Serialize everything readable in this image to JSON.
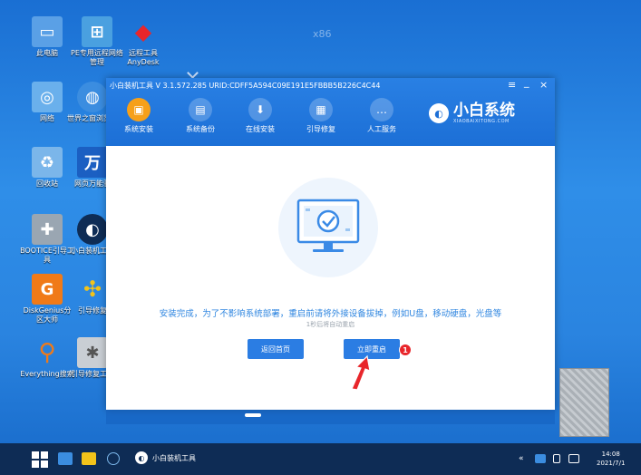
{
  "desktop": {
    "watermark": "x86",
    "icons": [
      {
        "label": "此电脑",
        "icon": "computer-icon",
        "color": "#5aa0e6"
      },
      {
        "label": "PE专用远程网络管理",
        "icon": "network-icon",
        "color": "#4aa0e0"
      },
      {
        "label": "远程工具AnyDesk",
        "icon": "anydesk-icon",
        "color": "#e8262b"
      },
      {
        "label": "网络",
        "icon": "network-icon",
        "color": "#6ab0ec"
      },
      {
        "label": "世界之窗浏览器",
        "icon": "globe-icon",
        "color": "#3b8de0"
      },
      {
        "label": "回收站",
        "icon": "recycle-bin-icon",
        "color": "#7bb6ea"
      },
      {
        "label": "网页万能驱",
        "icon": "wan-icon",
        "color": "#1b5fc2"
      },
      {
        "label": "BOOTICE引导工具",
        "icon": "tools-icon",
        "color": "#9aa6b2"
      },
      {
        "label": "小白装机工具",
        "icon": "xiaobai-icon",
        "color": "#0e2c55"
      },
      {
        "label": "DiskGenius分区大师",
        "icon": "diskgenius-icon",
        "color": "#f07a18"
      },
      {
        "label": "引导修复",
        "icon": "pinwheel-icon",
        "color": "#f2c31a"
      },
      {
        "label": "Everything搜索",
        "icon": "search-icon",
        "color": "#f07a18"
      },
      {
        "label": "引导修复工具",
        "icon": "repair-tools-icon",
        "color": "#c9ced4"
      }
    ]
  },
  "window": {
    "title": "小白装机工具 V 3.1.572.285 URID:CDFF5A594C09E191E5FBBB5B226C4C44",
    "controls": {
      "menu": "≡",
      "minimize": "_",
      "close": "×"
    },
    "nav": [
      {
        "label": "系统安装",
        "icon": "system-install-icon",
        "active": true
      },
      {
        "label": "系统备份",
        "icon": "backup-icon",
        "active": false
      },
      {
        "label": "在线安装",
        "icon": "online-install-icon",
        "active": false
      },
      {
        "label": "引导修复",
        "icon": "boot-repair-icon",
        "active": false
      },
      {
        "label": "人工服务",
        "icon": "chat-icon",
        "active": false
      }
    ],
    "brand": {
      "title": "小白系统",
      "subtitle": "XIAOBAIXITONG.COM"
    },
    "message": "安装完成，为了不影响系统部署，重启前请将外接设备拔掉，例如U盘，移动硬盘，光盘等",
    "countdown": "1秒后将自动重启",
    "buttons": {
      "home": "返回首页",
      "restart": "立即重启"
    },
    "badge": "1"
  },
  "taskbar": {
    "app_label": "小白装机工具",
    "clock_time": "14:08",
    "clock_date": "2021/7/1",
    "tray_expand": "«"
  },
  "colors": {
    "accent": "#2b7de3",
    "header": "#1c6fd6",
    "active_nav": "#f6a01a",
    "badge": "#e8262b",
    "taskbar": "#0e2c55"
  }
}
